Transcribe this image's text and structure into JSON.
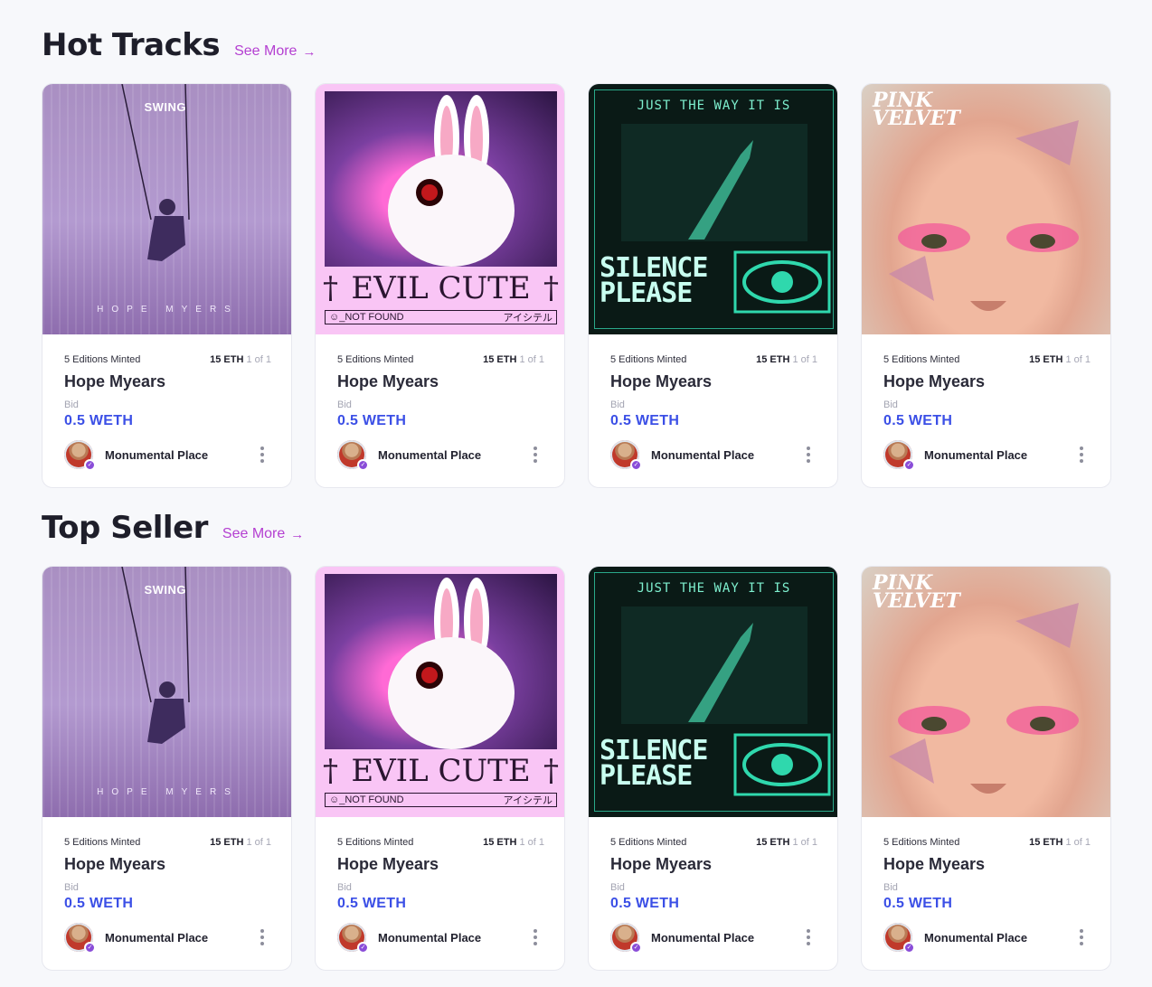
{
  "sections": [
    {
      "title": "Hot Tracks",
      "see_more": "See More",
      "cards": [
        {
          "art": "swing",
          "art_title": "SWING",
          "art_credit": "HOPE   MYERS",
          "editions": "5 Editions Minted",
          "price": "15 ETH",
          "of": "1 of 1",
          "name": "Hope Myears",
          "bid_label": "Bid",
          "bid_value": "0.5 WETH",
          "owner": "Monumental Place"
        },
        {
          "art": "evil",
          "art_title": "EVIL CUTE",
          "art_left": "NOT FOUND",
          "art_right": "アイシテル",
          "editions": "5 Editions Minted",
          "price": "15 ETH",
          "of": "1 of 1",
          "name": "Hope Myears",
          "bid_label": "Bid",
          "bid_value": "0.5 WETH",
          "owner": "Monumental Place"
        },
        {
          "art": "silence",
          "art_title": "JUST THE WAY IT IS",
          "art_big": "SILENCE PLEASE",
          "editions": "5 Editions Minted",
          "price": "15 ETH",
          "of": "1 of 1",
          "name": "Hope Myears",
          "bid_label": "Bid",
          "bid_value": "0.5 WETH",
          "owner": "Monumental Place"
        },
        {
          "art": "velvet",
          "art_title": "PINK VELVET",
          "editions": "5 Editions Minted",
          "price": "15 ETH",
          "of": "1 of 1",
          "name": "Hope Myears",
          "bid_label": "Bid",
          "bid_value": "0.5 WETH",
          "owner": "Monumental Place"
        }
      ]
    },
    {
      "title": "Top Seller",
      "see_more": "See More",
      "cards": [
        {
          "art": "swing",
          "art_title": "SWING",
          "art_credit": "HOPE   MYERS",
          "editions": "5 Editions Minted",
          "price": "15 ETH",
          "of": "1 of 1",
          "name": "Hope Myears",
          "bid_label": "Bid",
          "bid_value": "0.5 WETH",
          "owner": "Monumental Place"
        },
        {
          "art": "evil",
          "art_title": "EVIL CUTE",
          "art_left": "NOT FOUND",
          "art_right": "アイシテル",
          "editions": "5 Editions Minted",
          "price": "15 ETH",
          "of": "1 of 1",
          "name": "Hope Myears",
          "bid_label": "Bid",
          "bid_value": "0.5 WETH",
          "owner": "Monumental Place"
        },
        {
          "art": "silence",
          "art_title": "JUST THE WAY IT IS",
          "art_big": "SILENCE PLEASE",
          "editions": "5 Editions Minted",
          "price": "15 ETH",
          "of": "1 of 1",
          "name": "Hope Myears",
          "bid_label": "Bid",
          "bid_value": "0.5 WETH",
          "owner": "Monumental Place"
        },
        {
          "art": "velvet",
          "art_title": "PINK VELVET",
          "editions": "5 Editions Minted",
          "price": "15 ETH",
          "of": "1 of 1",
          "name": "Hope Myears",
          "bid_label": "Bid",
          "bid_value": "0.5 WETH",
          "owner": "Monumental Place"
        }
      ]
    }
  ],
  "icons": {
    "see_more": "arrow-right-icon",
    "menu": "kebab-menu-icon",
    "verified": "verified-badge-icon"
  },
  "colors": {
    "accent": "#b43fd1",
    "bid": "#3b4fe6",
    "badge": "#8a4dd8"
  }
}
